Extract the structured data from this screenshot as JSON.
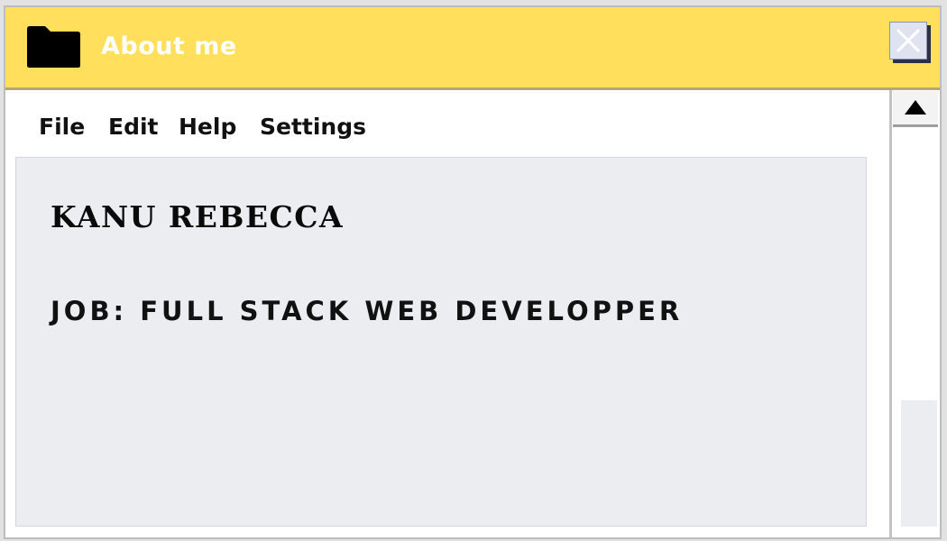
{
  "window": {
    "title": "About me",
    "icons": {
      "folder": "folder-icon",
      "close": "close-icon",
      "scroll_up": "triangle-up-icon"
    },
    "colors": {
      "titlebar": "#ffdf5c",
      "content_bg": "#ecedf1"
    }
  },
  "menu": {
    "items": [
      "File",
      "Edit",
      "Help",
      "Settings"
    ]
  },
  "profile": {
    "name": "KANU REBECCA",
    "job": "JOB: FULL STACK WEB DEVELOPPER"
  }
}
